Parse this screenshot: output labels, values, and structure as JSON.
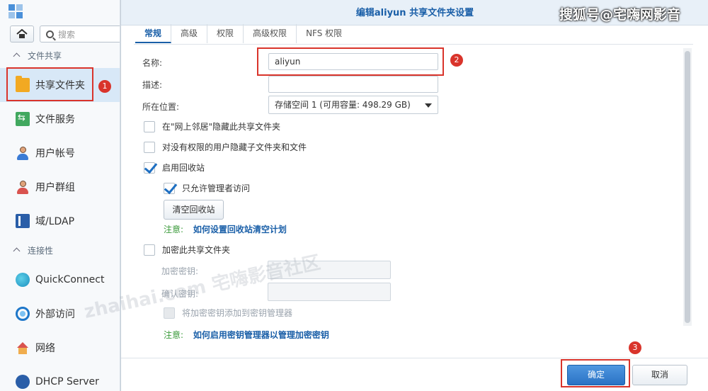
{
  "sidebar": {
    "search_placeholder": "搜索",
    "sections": {
      "file_sharing": "文件共享",
      "connectivity": "连接性"
    },
    "items": [
      {
        "label": "共享文件夹"
      },
      {
        "label": "文件服务"
      },
      {
        "label": "用户帐号"
      },
      {
        "label": "用户群组"
      },
      {
        "label": "域/LDAP"
      },
      {
        "label": "QuickConnect"
      },
      {
        "label": "外部访问"
      },
      {
        "label": "网络"
      },
      {
        "label": "DHCP Server"
      }
    ]
  },
  "dialog": {
    "title": "编辑aliyun 共享文件夹设置",
    "tabs": [
      "常规",
      "高级",
      "权限",
      "高级权限",
      "NFS 权限"
    ],
    "fields": {
      "name_label": "名称:",
      "name_value": "aliyun",
      "desc_label": "描述:",
      "desc_value": "",
      "location_label": "所在位置:",
      "location_value": "存储空间 1 (可用容量:  498.29 GB)"
    },
    "checks": {
      "hide_network": "在\"网上邻居\"隐藏此共享文件夹",
      "hide_subfolders": "对没有权限的用户隐藏子文件夹和文件",
      "recycle_bin": "启用回收站",
      "admin_only": "只允许管理者访问",
      "encrypt": "加密此共享文件夹",
      "add_key_manager": "将加密密钥添加到密钥管理器"
    },
    "buttons": {
      "empty_recycle": "清空回收站",
      "ok": "确定",
      "cancel": "取消"
    },
    "notes": {
      "prefix": "注意:",
      "recycle_link": "如何设置回收站清空计划",
      "key_link": "如何启用密钥管理器以管理加密密钥"
    },
    "password": {
      "key_label": "加密密钥:",
      "confirm_label": "确认密钥:"
    }
  },
  "annotations": [
    "1",
    "2",
    "3"
  ],
  "watermark": {
    "top_right": "搜狐号@宅嗨网影音",
    "ghost": "zhaihai.com 宅嗨影音社区"
  },
  "colors": {
    "accent": "#1a5fa8",
    "annotation": "#d9342b",
    "active_nav": "#d8e8f7"
  }
}
